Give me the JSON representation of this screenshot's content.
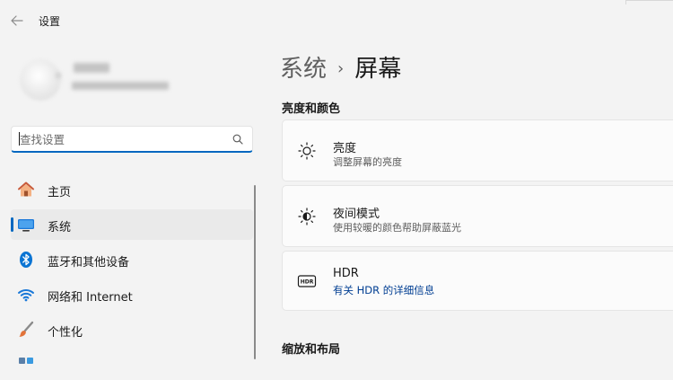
{
  "window": {
    "title": "设置"
  },
  "search": {
    "placeholder": "查找设置"
  },
  "sidebar": {
    "items": [
      {
        "label": "主页",
        "icon": "home-icon"
      },
      {
        "label": "系统",
        "icon": "system-icon",
        "active": true
      },
      {
        "label": "蓝牙和其他设备",
        "icon": "bluetooth-icon"
      },
      {
        "label": "网络和 Internet",
        "icon": "wifi-icon"
      },
      {
        "label": "个性化",
        "icon": "brush-icon"
      }
    ]
  },
  "breadcrumb": {
    "parent": "系统",
    "separator": "›",
    "current": "屏幕"
  },
  "sections": {
    "brightness_color": "亮度和颜色",
    "scale_layout": "缩放和布局"
  },
  "cards": {
    "brightness": {
      "title": "亮度",
      "subtitle": "调整屏幕的亮度",
      "icon": "sun-icon"
    },
    "night_light": {
      "title": "夜间模式",
      "subtitle": "使用较暖的颜色帮助屏蔽蓝光",
      "icon": "night-light-icon"
    },
    "hdr": {
      "title": "HDR",
      "link": "有关 HDR 的详细信息",
      "icon": "hdr-icon"
    }
  },
  "colors": {
    "accent": "#0067c0",
    "link": "#003e92",
    "background": "#f3f3f3",
    "card": "#fbfbfb"
  }
}
